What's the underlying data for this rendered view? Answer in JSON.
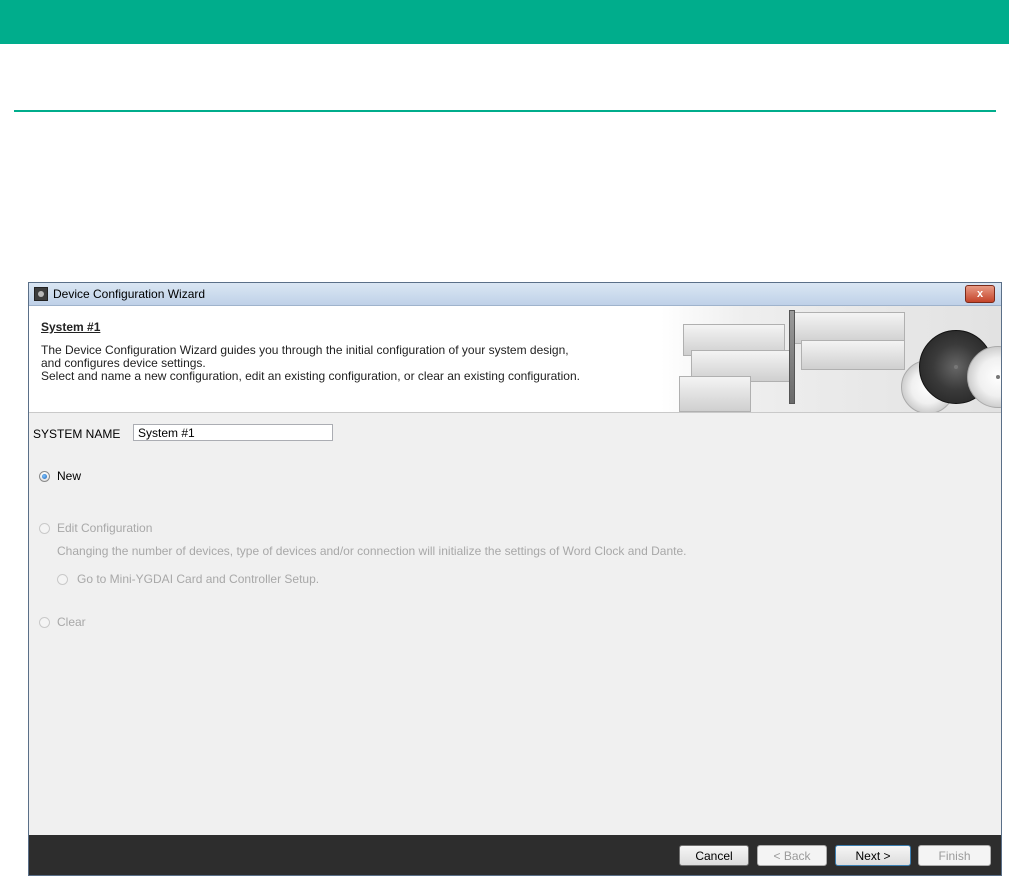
{
  "window": {
    "title": "Device Configuration Wizard",
    "close_label": "x"
  },
  "header": {
    "heading": "System #1",
    "description_lines": [
      "The Device Configuration Wizard guides you through the initial configuration of your system design,",
      "and configures device settings.",
      "Select and name a new configuration, edit an existing configuration, or clear an existing configuration."
    ]
  },
  "system_name": {
    "label": "SYSTEM NAME",
    "value": "System #1"
  },
  "options": {
    "new": {
      "label": "New",
      "selected": true,
      "enabled": true
    },
    "edit": {
      "label": "Edit Configuration",
      "selected": false,
      "enabled": false,
      "note": "Changing the number of devices, type of devices and/or connection will initialize the settings of Word Clock and Dante.",
      "sub_option": {
        "label": "Go to Mini-YGDAI Card and Controller Setup.",
        "selected": false,
        "enabled": false
      }
    },
    "clear": {
      "label": "Clear",
      "selected": false,
      "enabled": false
    }
  },
  "buttons": {
    "cancel": "Cancel",
    "back": "< Back",
    "next": "Next >",
    "finish": "Finish"
  },
  "colors": {
    "accent": "#00ad8c",
    "footer": "#2d2d2d"
  },
  "icons": {
    "app": "mixer-icon",
    "close": "close-icon"
  }
}
